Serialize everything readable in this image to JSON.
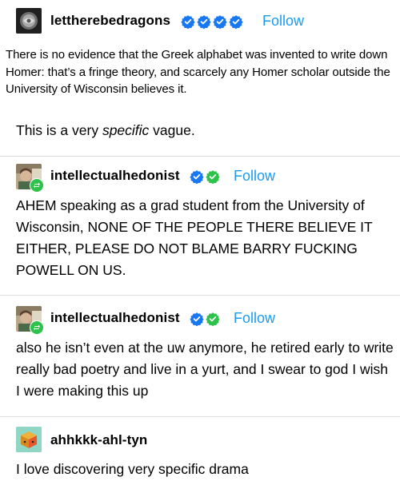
{
  "posts": [
    {
      "username": "lettherebedragons",
      "follow_label": "Follow",
      "quote": "There is no evidence that the Greek alphabet was invented to write down Homer: that’s a fringe theory, and scarcely any Homer scholar outside the University of Wisconsin believes it.",
      "body_pre": "This is a very ",
      "body_em": "specific",
      "body_post": " vague."
    },
    {
      "username": "intellectualhedonist",
      "follow_label": "Follow",
      "body": "AHEM speaking as a grad student from the University of Wisconsin, NONE OF THE PEOPLE THERE BELIEVE IT EITHER, PLEASE DO NOT BLAME BARRY FUCKING POWELL ON US."
    },
    {
      "username": "intellectualhedonist",
      "follow_label": "Follow",
      "body": "also he isn’t even at the uw anymore, he retired early to write really bad poetry and live in a yurt, and I swear to god I wish I were making this up"
    },
    {
      "username": "ahhkkk-ahl-tyn",
      "body": "I love discovering very specific drama"
    }
  ],
  "colors": {
    "follow": "#1a9bf0",
    "verified_blue": "#1877f2",
    "verified_green": "#2dc24a"
  }
}
